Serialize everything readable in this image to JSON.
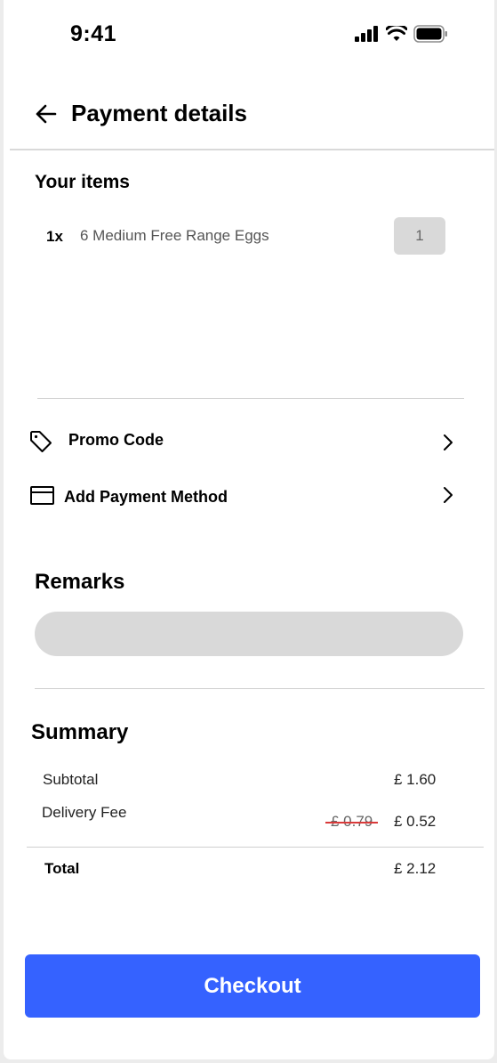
{
  "status_bar": {
    "time": "9:41"
  },
  "header": {
    "title": "Payment details"
  },
  "items_section": {
    "heading": "Your items",
    "items": [
      {
        "qty_prefix": "1x",
        "name": "6 Medium Free Range Eggs",
        "quantity": "1"
      }
    ]
  },
  "options": {
    "promo_label": "Promo Code",
    "payment_label": "Add Payment Method"
  },
  "remarks": {
    "heading": "Remarks",
    "value": ""
  },
  "summary": {
    "heading": "Summary",
    "subtotal_label": "Subtotal",
    "subtotal_value": "£ 1.60",
    "delivery_label": "Delivery Fee",
    "delivery_old_value": "£ 0.79",
    "delivery_value": "£ 0.52",
    "total_label": "Total",
    "total_value": "£ 2.12"
  },
  "checkout_label": "Checkout",
  "colors": {
    "accent": "#3562ff",
    "strike": "#d93a3a",
    "field": "#d9d9d9"
  },
  "icons": [
    "signal-icon",
    "wifi-icon",
    "battery-icon",
    "back-arrow-icon",
    "tag-icon",
    "card-icon",
    "chevron-right-icon"
  ]
}
